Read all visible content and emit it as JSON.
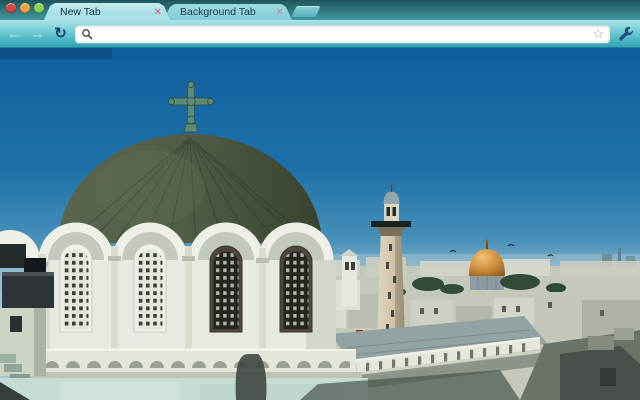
{
  "window_controls": {
    "close_color": "#e0443e",
    "minimize_color": "#f0a33a",
    "zoom_color": "#8bd549"
  },
  "tabstrip": {
    "tabs": [
      {
        "label": "New Tab",
        "active": true,
        "close_glyph": "×"
      },
      {
        "label": "Background Tab",
        "active": false,
        "close_glyph": "×"
      }
    ]
  },
  "toolbar": {
    "back_glyph": "←",
    "forward_glyph": "→",
    "reload_glyph": "↻",
    "star_glyph": "☆",
    "back_enabled": false,
    "forward_enabled": false,
    "omnibox_value": "",
    "omnibox_placeholder": ""
  },
  "theme": {
    "frame_top": "#1c545c",
    "frame_bottom": "#45989f",
    "active_tab": "#a6e0e5",
    "inactive_tab": "#83cbd5",
    "toolbar_top": "#ace2e7",
    "toolbar_bottom": "#33a4b4",
    "tab_text": "#1b2e4a",
    "close_x_color": "#df6e7e",
    "reload_color": "#173f6d",
    "wrench_color": "#23527c",
    "sky_top": "#0f5f9e",
    "sky_horizon": "#a3c4d0",
    "church_dome": "#4c5843",
    "gold_dome": "#cc8f3e"
  },
  "content_photo": {
    "subject": "Aerial view of Jerusalem Old City rooftops",
    "landmarks": [
      "church dome with patina cross",
      "white drum with arched grid windows",
      "minaret tower with balcony",
      "Dome of the Rock golden dome",
      "city rooftops and balustrade"
    ]
  }
}
